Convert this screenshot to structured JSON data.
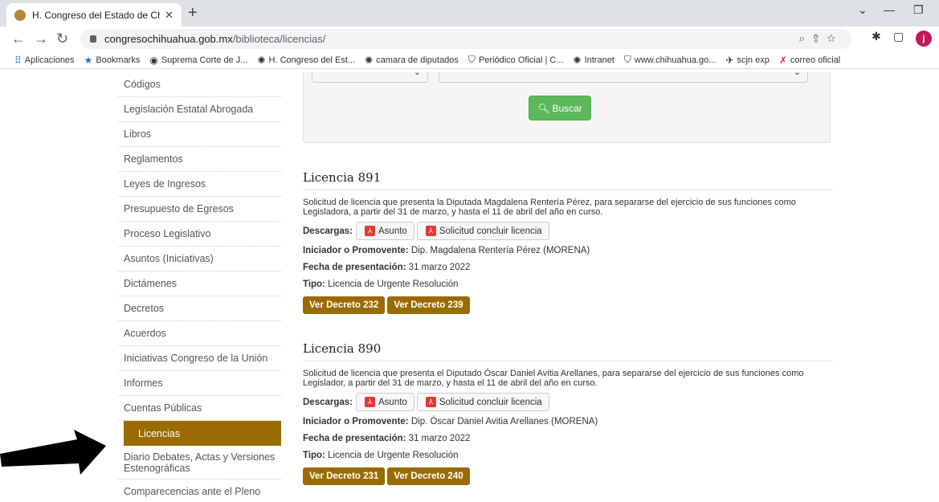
{
  "browser": {
    "tab_title": "H. Congreso del Estado de Chihu",
    "url_domain": "congresochihuahua.gob.mx",
    "url_path": "/biblioteca/licencias/",
    "profile_initial": "j",
    "bookmarks": [
      {
        "label": "Aplicaciones",
        "icon": "apps-grid-icon"
      },
      {
        "label": "Bookmarks",
        "icon": "star-icon"
      },
      {
        "label": "Suprema Corte de J...",
        "icon": "globe-icon"
      },
      {
        "label": "H. Congreso del Est...",
        "icon": "seal-icon"
      },
      {
        "label": "camara de diputados",
        "icon": "seal-icon"
      },
      {
        "label": "Periódico Oficial | C...",
        "icon": "shield-icon"
      },
      {
        "label": "Intranet",
        "icon": "seal-icon"
      },
      {
        "label": "www.chihuahua.go...",
        "icon": "shield-icon"
      },
      {
        "label": "scjn exp",
        "icon": "bird-icon"
      },
      {
        "label": "correo oficial",
        "icon": "x-icon"
      }
    ]
  },
  "sidebar": {
    "items": [
      {
        "label": "Códigos"
      },
      {
        "label": "Legislación Estatal Abrogada"
      },
      {
        "label": "Libros"
      },
      {
        "label": "Reglamentos"
      },
      {
        "label": "Leyes de Ingresos"
      },
      {
        "label": "Presupuesto de Egresos"
      },
      {
        "label": "Proceso Legislativo"
      },
      {
        "label": "Asuntos (Iniciativas)"
      },
      {
        "label": "Dictámenes"
      },
      {
        "label": "Decretos"
      },
      {
        "label": "Acuerdos"
      },
      {
        "label": "Iniciativas Congreso de la Unión"
      },
      {
        "label": "Informes"
      },
      {
        "label": "Cuentas Públicas"
      },
      {
        "label": "Licencias",
        "active": true
      },
      {
        "label": "Diario Debates, Actas y Versiones Estenográficas"
      },
      {
        "label": "Comparecencias ante el Pleno"
      }
    ]
  },
  "search": {
    "button_label": "Buscar"
  },
  "licencias": [
    {
      "title": "Licencia 891",
      "description": "Solicitud de licencia que presenta la Diputada Magdalena Rentería Pérez, para separarse del ejercicio de sus funciones como Legisladora, a partir del 31 de marzo, y hasta el 11 de abril del año en curso.",
      "downloads_label": "Descargas:",
      "downloads": [
        "Asunto",
        "Solicitud concluir licencia"
      ],
      "promovente_label": "Iniciador o Promovente:",
      "promovente": "Dip. Magdalena Rentería Pérez (MORENA)",
      "fecha_label": "Fecha de presentación:",
      "fecha": "31 marzo 2022",
      "tipo_label": "Tipo:",
      "tipo": "Licencia de Urgente Resolución",
      "decretos": [
        "Ver Decreto 232",
        "Ver Decreto 239"
      ]
    },
    {
      "title": "Licencia 890",
      "description": "Solicitud de licencia que presenta el Diputado Óscar Daniel Avitia Arellanes, para separarse del ejercicio de sus funciones como Legislador, a partir del 31 de marzo, y hasta el 11 de abril del año en curso.",
      "downloads_label": "Descargas:",
      "downloads": [
        "Asunto",
        "Solicitud concluir licencia"
      ],
      "promovente_label": "Iniciador o Promovente:",
      "promovente": "Dip. Óscar Daniel Avitia Arellanes (MORENA)",
      "fecha_label": "Fecha de presentación:",
      "fecha": "31 marzo 2022",
      "tipo_label": "Tipo:",
      "tipo": "Licencia de Urgente Resolución",
      "decretos": [
        "Ver Decreto 231",
        "Ver Decreto 240"
      ]
    }
  ],
  "colors": {
    "accent": "#9a6b00",
    "search_button": "#5cb85c",
    "pdf_icon": "#e53935"
  }
}
